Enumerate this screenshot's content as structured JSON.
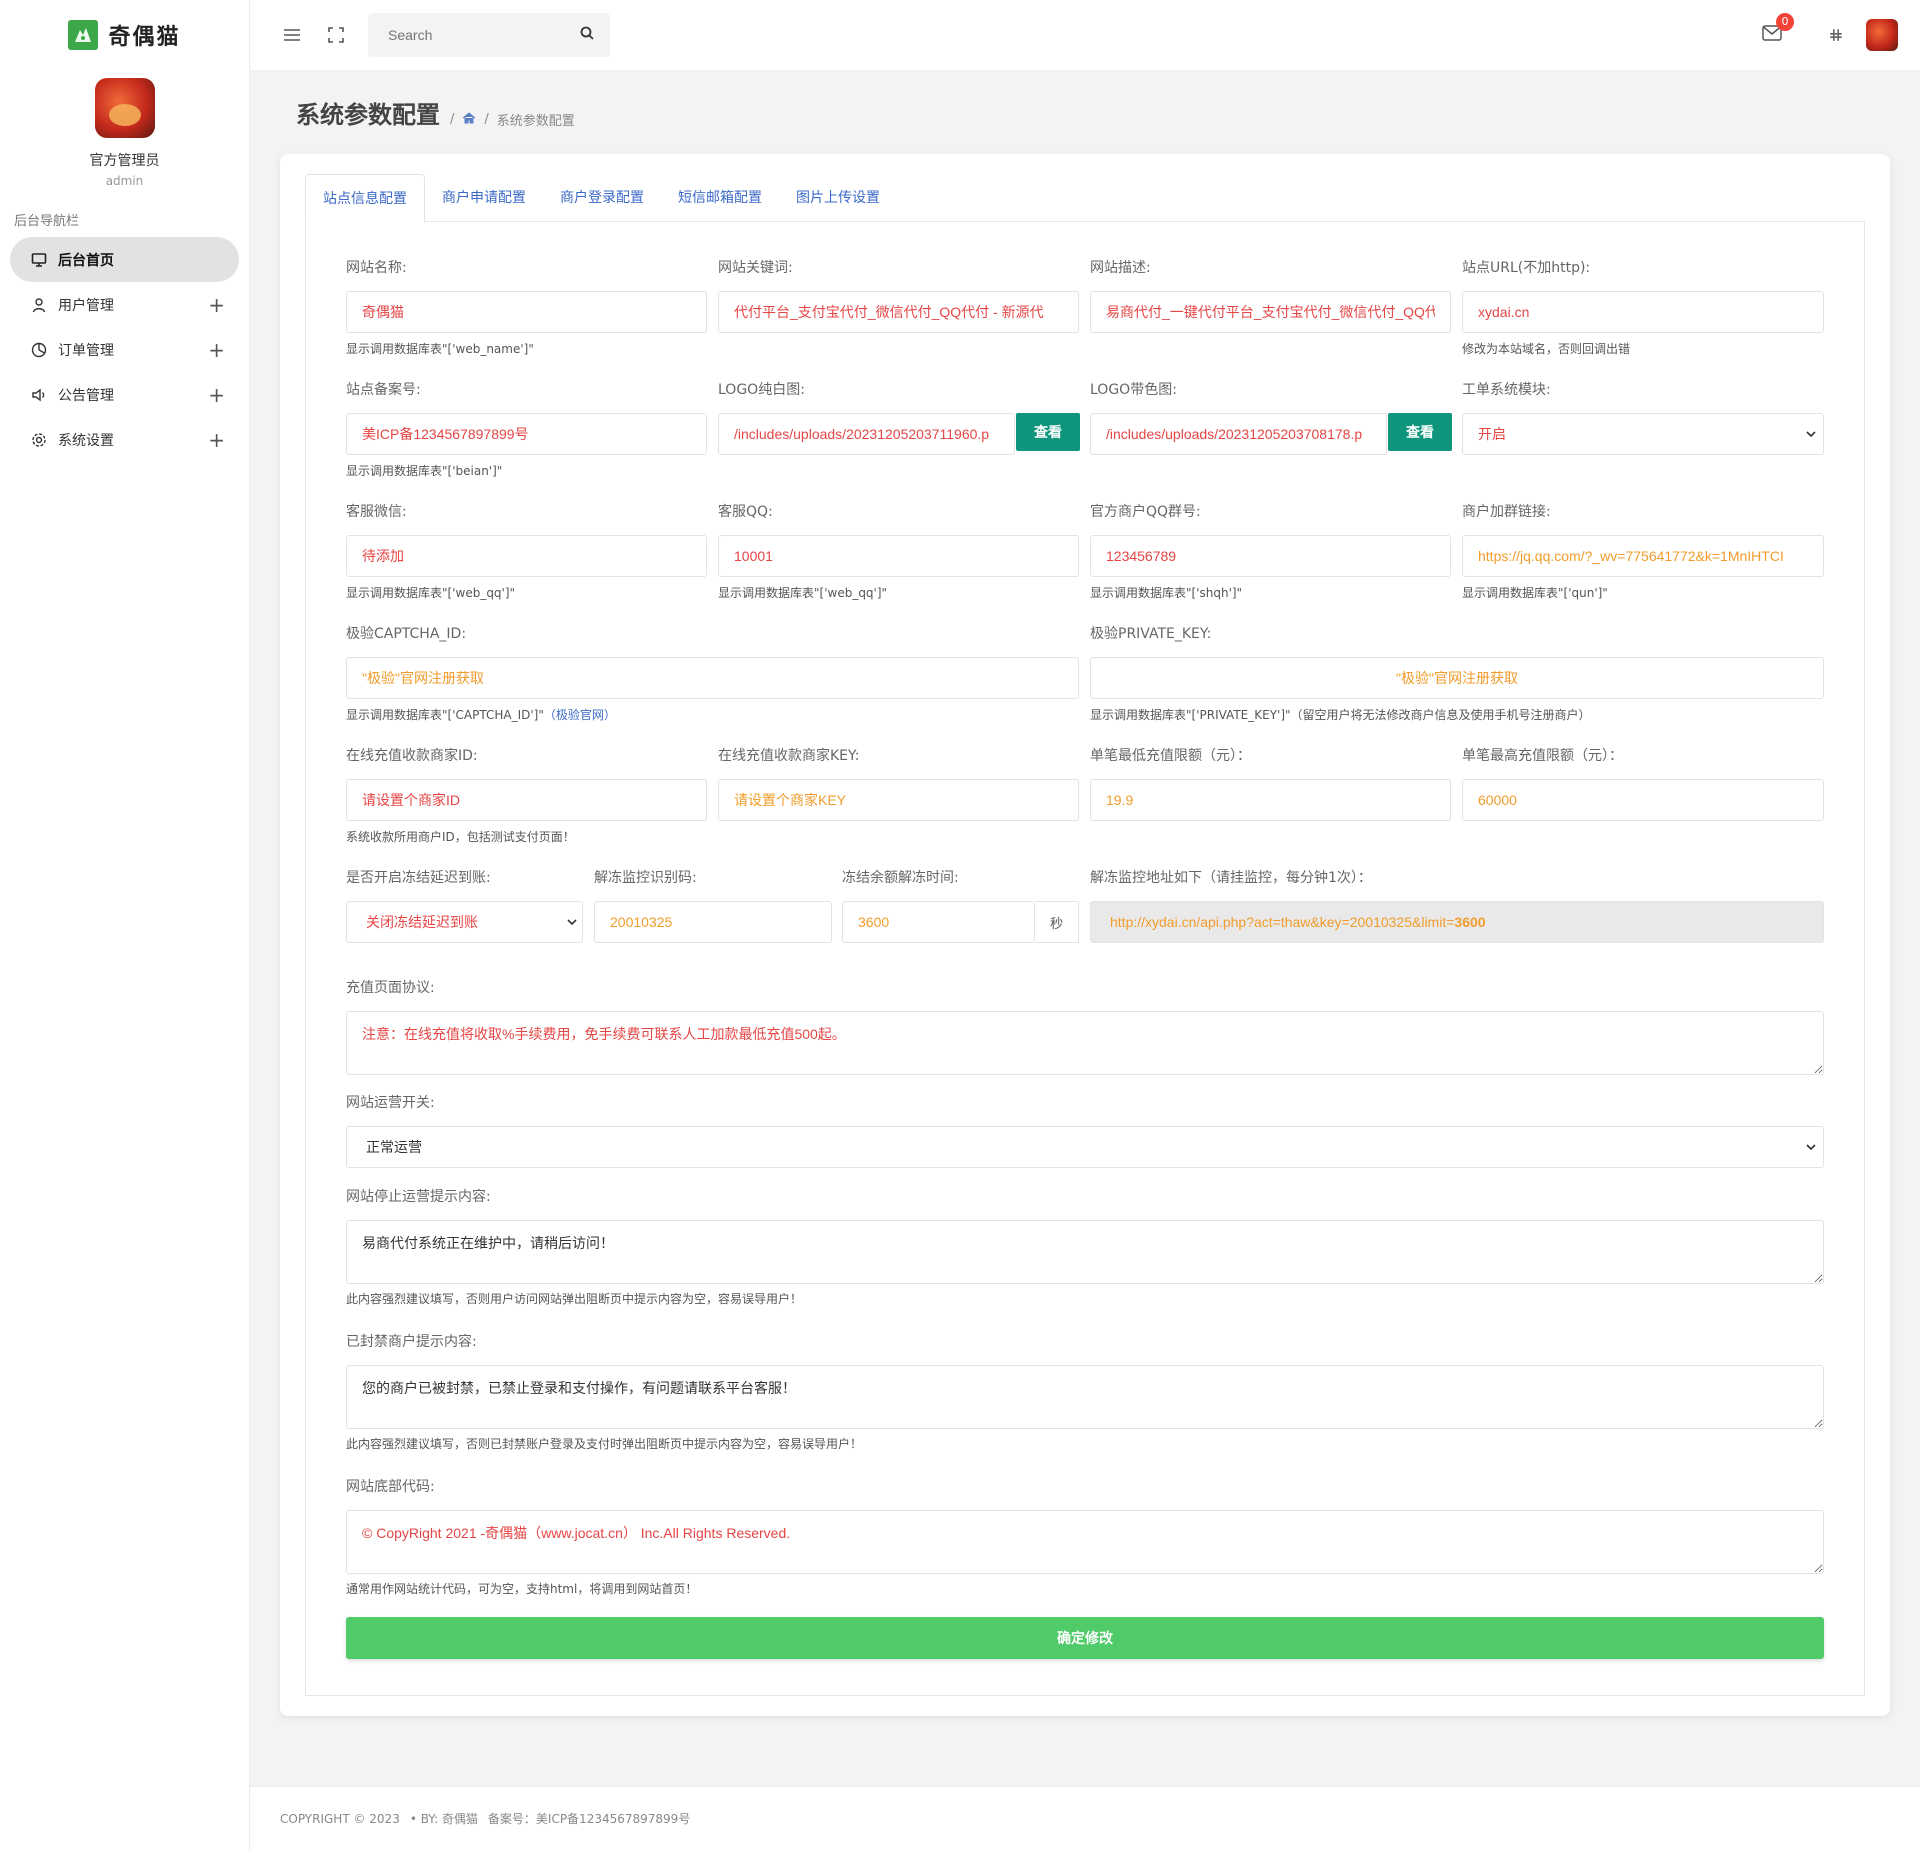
{
  "brand": {
    "name": "奇偶猫",
    "logo_icon": "cat-logo-icon",
    "color": "#3ca84a"
  },
  "profile": {
    "name": "官方管理员",
    "role": "admin"
  },
  "nav": {
    "title": "后台导航栏",
    "items": [
      {
        "label": "后台首页",
        "icon": "monitor-icon",
        "active": true,
        "expandable": false
      },
      {
        "label": "用户管理",
        "icon": "user-icon",
        "expandable": true
      },
      {
        "label": "订单管理",
        "icon": "pie-chart-icon",
        "expandable": true
      },
      {
        "label": "公告管理",
        "icon": "speaker-icon",
        "expandable": true
      },
      {
        "label": "系统设置",
        "icon": "gear-icon",
        "expandable": true
      }
    ],
    "plus": "+"
  },
  "topbar": {
    "search_placeholder": "Search",
    "mail_badge": "0"
  },
  "page": {
    "title": "系统参数配置",
    "sep": "/",
    "breadcrumb_current": "系统参数配置"
  },
  "tabs": [
    "站点信息配置",
    "商户申请配置",
    "商户登录配置",
    "短信邮箱配置",
    "图片上传设置"
  ],
  "form": {
    "web_name": {
      "label": "网站名称:",
      "value": "奇偶猫",
      "hint": "显示调用数据库表\"['web_name']\""
    },
    "keywords": {
      "label": "网站关键词:",
      "value": "代付平台_支付宝代付_微信代付_QQ代付 - 新源代"
    },
    "description": {
      "label": "网站描述:",
      "value": "易商代付_一键代付平台_支付宝代付_微信代付_QQ代"
    },
    "site_url": {
      "label": "站点URL(不加http):",
      "value": "xydai.cn",
      "hint": "修改为本站域名，否则回调出错"
    },
    "beian": {
      "label": "站点备案号:",
      "value": "美ICP备1234567897899号",
      "hint": "显示调用数据库表\"['beian']\""
    },
    "logo_white": {
      "label": "LOGO纯白图:",
      "value": "/includes/uploads/20231205203711960.p",
      "button": "查看"
    },
    "logo_color": {
      "label": "LOGO带色图:",
      "value": "/includes/uploads/20231205203708178.p",
      "button": "查看"
    },
    "ticket": {
      "label": "工单系统模块:",
      "value": "开启"
    },
    "wechat": {
      "label": "客服微信:",
      "value": "待添加",
      "hint": "显示调用数据库表\"['web_qq']\""
    },
    "qq": {
      "label": "客服QQ:",
      "value": "10001",
      "hint": "显示调用数据库表\"['web_qq']\""
    },
    "qq_group": {
      "label": "官方商户QQ群号:",
      "value": "123456789",
      "hint": "显示调用数据库表\"['shqh']\""
    },
    "group_link": {
      "label": "商户加群链接:",
      "value": "https://jq.qq.com/?_wv=775641772&k=1MnIHTCI",
      "hint": "显示调用数据库表\"['qun']\""
    },
    "captcha_id": {
      "label": "极验CAPTCHA_ID:",
      "value": "\"极验\"官网注册获取",
      "hint": "显示调用数据库表\"['CAPTCHA_ID']\"",
      "hint_link": "（极验官网）"
    },
    "private_key": {
      "label": "极验PRIVATE_KEY:",
      "value": "\"极验\"官网注册获取",
      "hint": "显示调用数据库表\"['PRIVATE_KEY']\"（留空用户将无法修改商户信息及使用手机号注册商户）"
    },
    "merchant_id": {
      "label": "在线充值收款商家ID:",
      "value": "请设置个商家ID",
      "hint": "系统收款所用商户ID，包括测试支付页面！"
    },
    "merchant_key": {
      "label": "在线充值收款商家KEY:",
      "value": "请设置个商家KEY"
    },
    "min_recharge": {
      "label": "单笔最低充值限额（元）：",
      "value": "19.9"
    },
    "max_recharge": {
      "label": "单笔最高充值限额（元）：",
      "value": "60000"
    },
    "freeze": {
      "label": "是否开启冻结延迟到账:",
      "value": "关闭冻结延迟到账"
    },
    "thaw_code": {
      "label": "解冻监控识别码:",
      "value": "20010325"
    },
    "thaw_time": {
      "label": "冻结余额解冻时间:",
      "value": "3600",
      "suffix": "秒"
    },
    "thaw_url": {
      "label": "解冻监控地址如下（请挂监控，每分钟1次）：",
      "value_prefix": "http://xydai.cn/api.php?act=thaw&key=20010325&limit=",
      "value_bold": "3600"
    },
    "agreement": {
      "label": "充值页面协议:",
      "value": "注意：在线充值将收取%手续费用，免手续费可联系人工加款最低充值500起。"
    },
    "switch": {
      "label": "网站运营开关:",
      "value": "正常运营"
    },
    "stop_msg": {
      "label": "网站停止运营提示内容:",
      "value": "易商代付系统正在维护中，请稍后访问！",
      "hint": "此内容强烈建议填写，否则用户访问网站弹出阻断页中提示内容为空，容易误导用户！"
    },
    "ban_msg": {
      "label": "已封禁商户提示内容:",
      "value": "您的商户已被封禁，已禁止登录和支付操作，有问题请联系平台客服！",
      "hint": "此内容强烈建议填写，否则已封禁账户登录及支付时弹出阻断页中提示内容为空，容易误导用户！"
    },
    "footer_code": {
      "label": "网站底部代码:",
      "value": "© CopyRight 2021 -奇偶猫（www.jocat.cn） Inc.All Rights Reserved.",
      "hint": "通常用作网站统计代码，可为空，支持html，将调用到网站首页！"
    },
    "submit": "确定修改"
  },
  "footer": {
    "copyright": "COPYRIGHT © 2023",
    "by": "• BY: 奇偶猫",
    "beian": "备案号：美ICP备1234567897899号"
  },
  "colors": {
    "value_red": "#e64545",
    "value_orange": "#f19c2c",
    "tab_blue": "#3c6ac8",
    "view_button": "#10957d",
    "submit_green": "#4fcb6a"
  }
}
